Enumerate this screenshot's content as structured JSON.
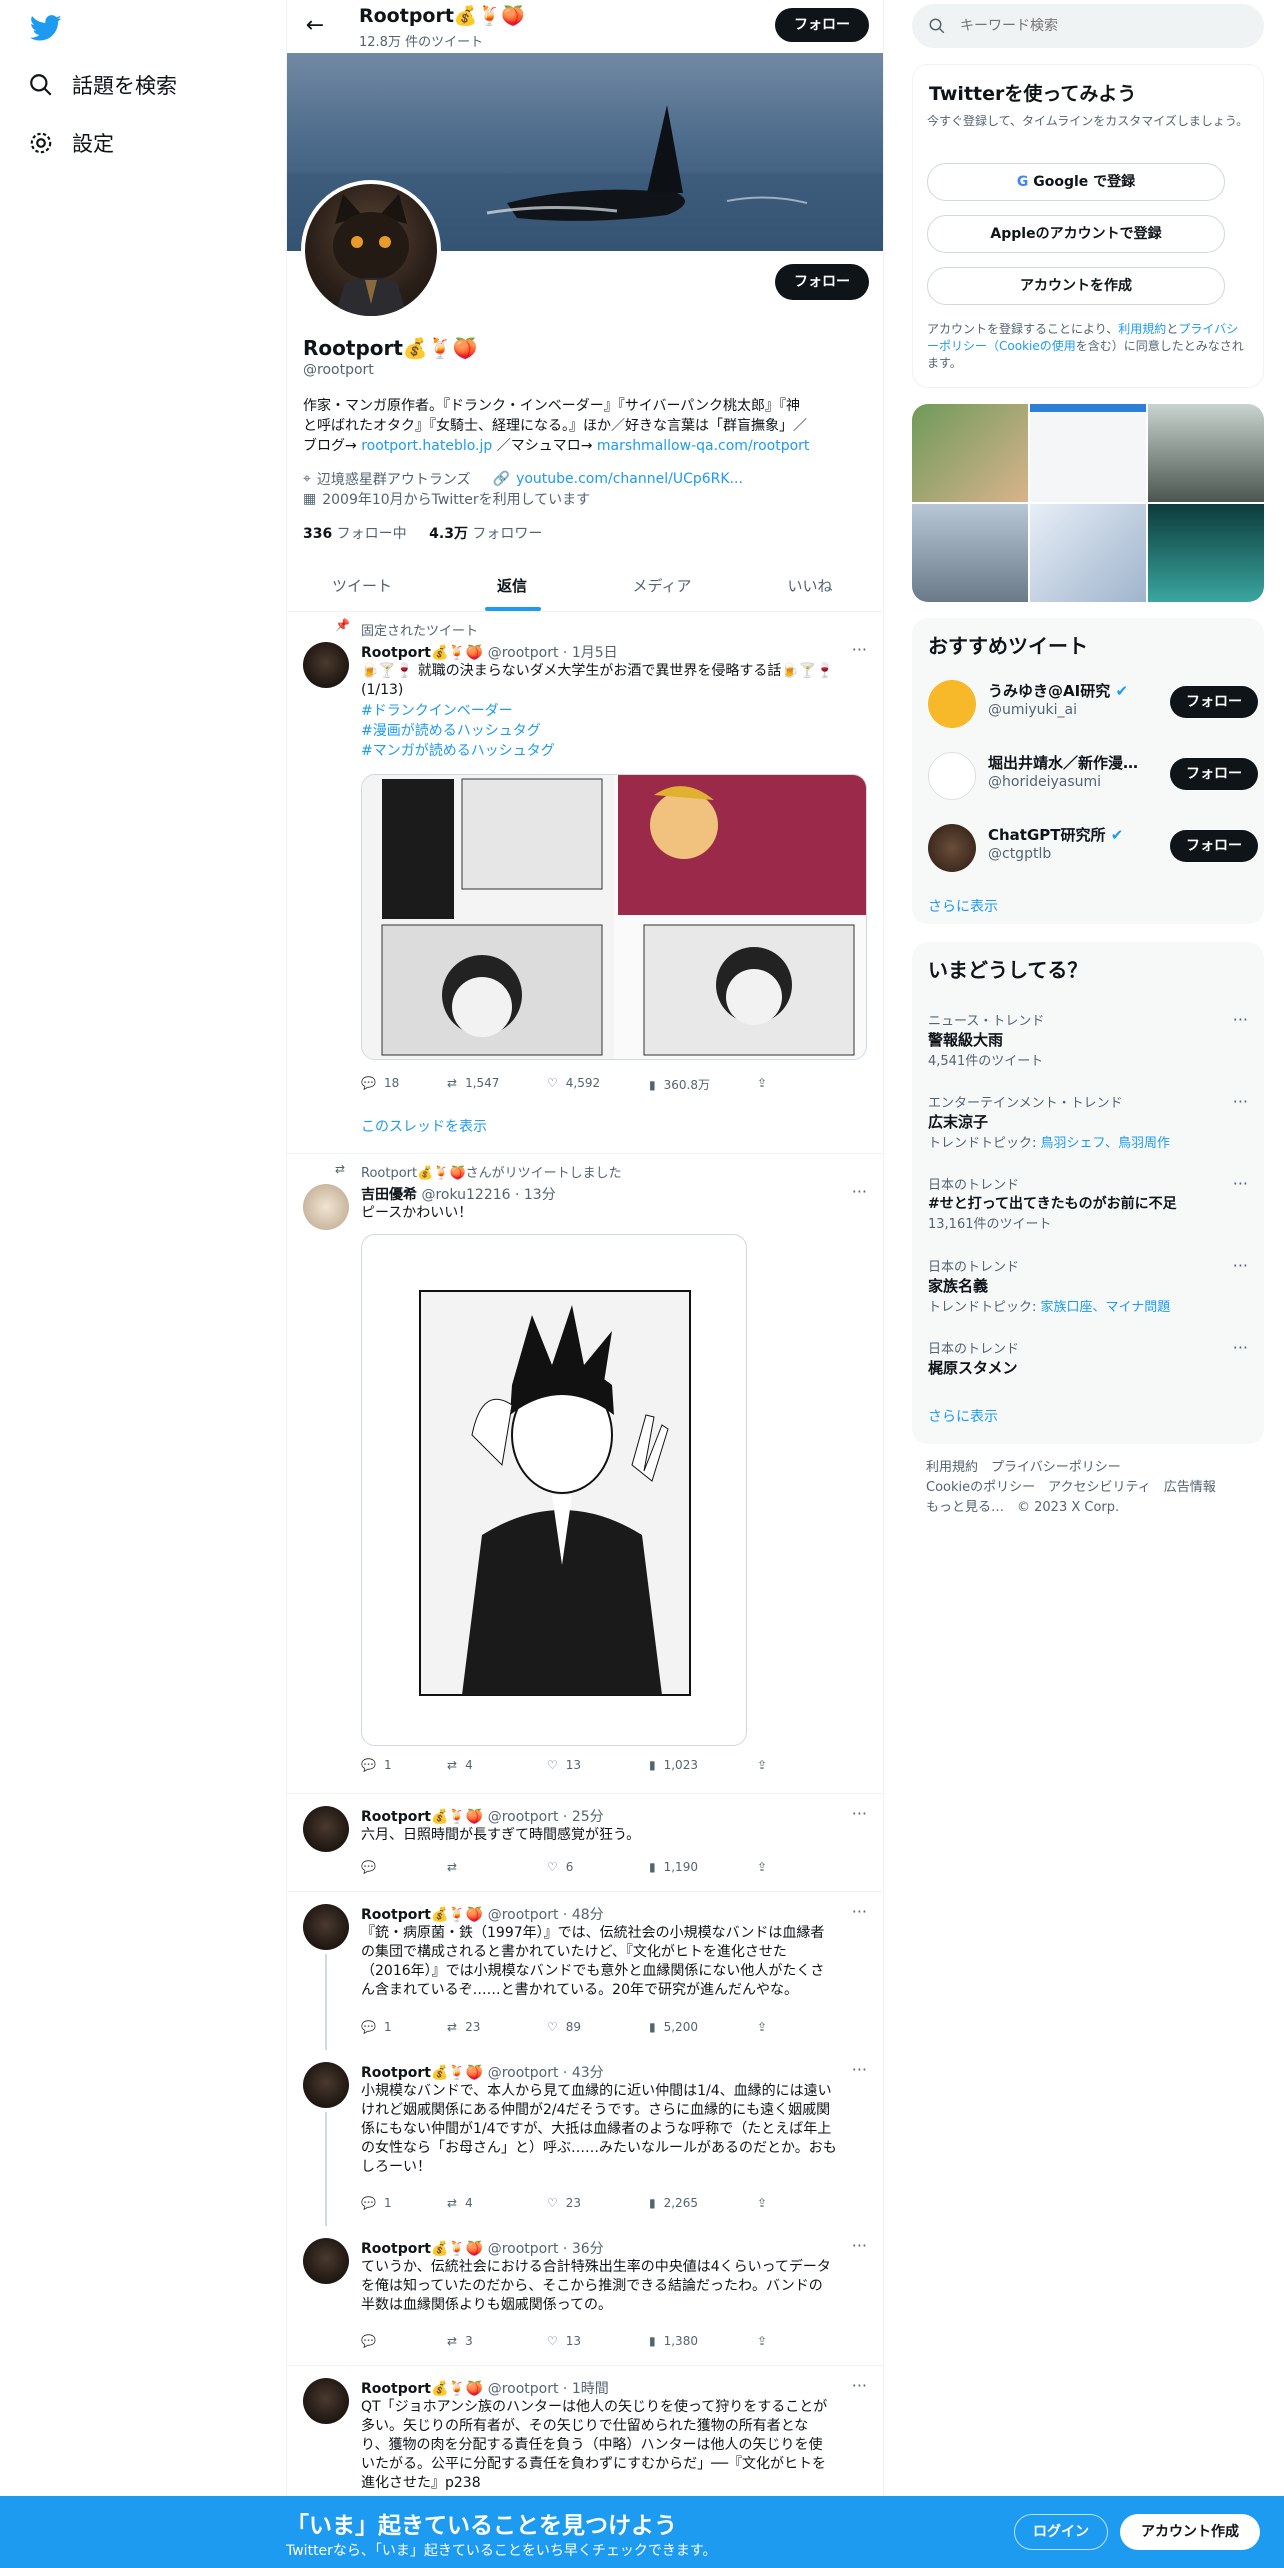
{
  "nav": {
    "search_label": "話題を検索",
    "settings_label": "設定"
  },
  "header": {
    "name": "Rootport💰🍹🍑",
    "tweet_count": "12.8万 件のツイート",
    "follow": "フォロー"
  },
  "profile": {
    "name": "Rootport💰🍹🍑",
    "handle": "@rootport",
    "follow": "フォロー",
    "bio_1": "作家・マンガ原作者。『ドランク・インベーダー』『サイバーパンク桃太郎』『神",
    "bio_2": "と呼ばれたオタク』『女騎士、経理になる。』ほか／好きな言葉は「群盲撫象」／",
    "bio_3a": "ブログ→ ",
    "bio_3_link1": "rootport.hateblo.jp",
    "bio_3b": " ／マシュマロ→ ",
    "bio_3_link2": "marshmallow-qa.com/rootport",
    "location": "辺境惑星群アウトランズ",
    "website": "youtube.com/channel/UCp6RK...",
    "joined": "2009年10月からTwitterを利用しています",
    "following_count": "336",
    "following_label": " フォロー中",
    "followers_count": "4.3万",
    "followers_label": " フォロワー"
  },
  "tabs": [
    "ツイート",
    "返信",
    "メディア",
    "いいね"
  ],
  "tweets": {
    "pinned": {
      "label": "固定されたツイート",
      "name": "Rootport💰🍹🍑",
      "handle": "@rootport · 1月5日",
      "text": "🍺🍸🍷 就職の決まらないダメ大学生がお酒で異世界を侵略する話🍺🍸🍷 (1/13)",
      "tag1": "#ドランクインベーダー",
      "tag2": "#漫画が読めるハッシュタグ",
      "tag3": "#マンガが読めるハッシュタグ",
      "replies": "18",
      "retweets": "1,547",
      "likes": "4,592",
      "views": "360.8万",
      "thread": "このスレッドを表示"
    },
    "rt": {
      "label": "Rootport💰🍹🍑さんがリツイートしました",
      "name": "吉田優希",
      "handle": "@roku12216 · 13分",
      "text": "ピースかわいい！",
      "replies": "1",
      "retweets": "4",
      "likes": "13",
      "views": "1,023"
    },
    "t3": {
      "name": "Rootport💰🍹🍑",
      "handle": "@rootport · 25分",
      "text": "六月、日照時間が長すぎて時間感覚が狂う。",
      "replies": "",
      "retweets": "",
      "likes": "6",
      "views": "1,190"
    },
    "t4": {
      "name": "Rootport💰🍹🍑",
      "handle": "@rootport · 48分",
      "l1": "『銃・病原菌・鉄（1997年）』では、伝統社会の小規模なバンドは血縁者",
      "l2": "の集団で構成されると書かれていたけど、『文化がヒトを進化させた",
      "l3": "（2016年）』では小規模なバンドでも意外と血縁関係にない他人がたくさ",
      "l4": "ん含まれているぞ……と書かれている。20年で研究が進んだんやな。",
      "replies": "1",
      "retweets": "23",
      "likes": "89",
      "views": "5,200"
    },
    "t5": {
      "name": "Rootport💰🍹🍑",
      "handle": "@rootport · 43分",
      "l1": "小規模なバンドで、本人から見て血縁的に近い仲間は1/4、血縁的には遠い",
      "l2": "けれど姻戚関係にある仲間が2/4だそうです。さらに血縁的にも遠く姻戚関",
      "l3": "係にもない仲間が1/4ですが、大抵は血縁者のような呼称で（たとえば年上",
      "l4": "の女性なら「お母さん」と）呼ぶ……みたいなルールがあるのだとか。おも",
      "l5": "しろーい！",
      "replies": "1",
      "retweets": "4",
      "likes": "23",
      "views": "2,265"
    },
    "t6": {
      "name": "Rootport💰🍹🍑",
      "handle": "@rootport · 36分",
      "l1": "ていうか、伝統社会における合計特殊出生率の中央値は4くらいってデータ",
      "l2": "を俺は知っていたのだから、そこから推測できる結論だったわ。バンドの",
      "l3": "半数は血縁関係よりも姻戚関係っての。",
      "replies": "",
      "retweets": "3",
      "likes": "13",
      "views": "1,380"
    },
    "t7": {
      "name": "Rootport💰🍹🍑",
      "handle": "@rootport · 1時間",
      "l1": "QT「ジョホアンシ族のハンターは他人の矢じりを使って狩りをすることが",
      "l2": "多い。矢じりの所有者が、その矢じりで仕留められた獲物の所有者とな",
      "l3": "り、獲物の肉を分配する責任を負う（中略）ハンターは他人の矢じりを使",
      "l4": "いたがる。公平に分配する責任を負わずにすむからだ」──『文化がヒトを",
      "l5": "進化させた』p238"
    }
  },
  "sidebar": {
    "search_placeholder": "キーワード検索",
    "signup": {
      "title": "Twitterを使ってみよう",
      "sub": "今すぐ登録して、タイムラインをカスタマイズしましょう。",
      "google": "Google で登録",
      "apple": "Appleのアカウントで登録",
      "create": "アカウントを作成",
      "legal_1": "アカウントを登録することにより、",
      "legal_terms": "利用規約",
      "legal_and": "と",
      "legal_privacy": "プライバシーポリシー",
      "legal_cookie": "（Cookieの使用",
      "legal_rest": "を含む）に同意したとみなされます。"
    },
    "recommend": {
      "title": "おすすめツイート",
      "more": "さらに表示",
      "users": [
        {
          "name": "うみゆき@AI研究",
          "handle": "@umiyuki_ai",
          "follow": "フォロー"
        },
        {
          "name": "堀出井靖水／新作漫…",
          "handle": "@horideiyasumi",
          "follow": "フォロー"
        },
        {
          "name": "ChatGPT研究所",
          "handle": "@ctgptlb",
          "follow": "フォロー"
        }
      ]
    },
    "trends": {
      "title": "いまどうしてる？",
      "more": "さらに表示",
      "items": [
        {
          "cat": "ニュース・トレンド",
          "name": "警報級大雨",
          "sub": "4,541件のツイート"
        },
        {
          "cat": "エンターテインメント・トレンド",
          "name": "広末涼子",
          "sub": "トレンドトピック: ",
          "sub_link": "鳥羽シェフ、鳥羽周作"
        },
        {
          "cat": "日本のトレンド",
          "name": "#せと打って出てきたものがお前に不足",
          "sub": "13,161件のツイート"
        },
        {
          "cat": "日本のトレンド",
          "name": "家族名義",
          "sub": "トレンドトピック: ",
          "sub_link": "家族口座、マイナ問題"
        },
        {
          "cat": "日本のトレンド",
          "name": "梶原スタメン",
          "sub": ""
        }
      ]
    },
    "footer": {
      "l1": "利用規約　プライバシーポリシー",
      "l2": "Cookieのポリシー　アクセシビリティ　広告情報",
      "l3": "もっと見る…　© 2023 X Corp."
    }
  },
  "bottom": {
    "title": "「いま」起きていることを見つけよう",
    "sub": "Twitterなら、「いま」起きていることをいち早くチェックできます。",
    "login": "ログイン",
    "signup": "アカウント作成"
  },
  "colors": {
    "accent": "#1d9bf0",
    "text": "#0f1419",
    "muted": "#536471"
  }
}
